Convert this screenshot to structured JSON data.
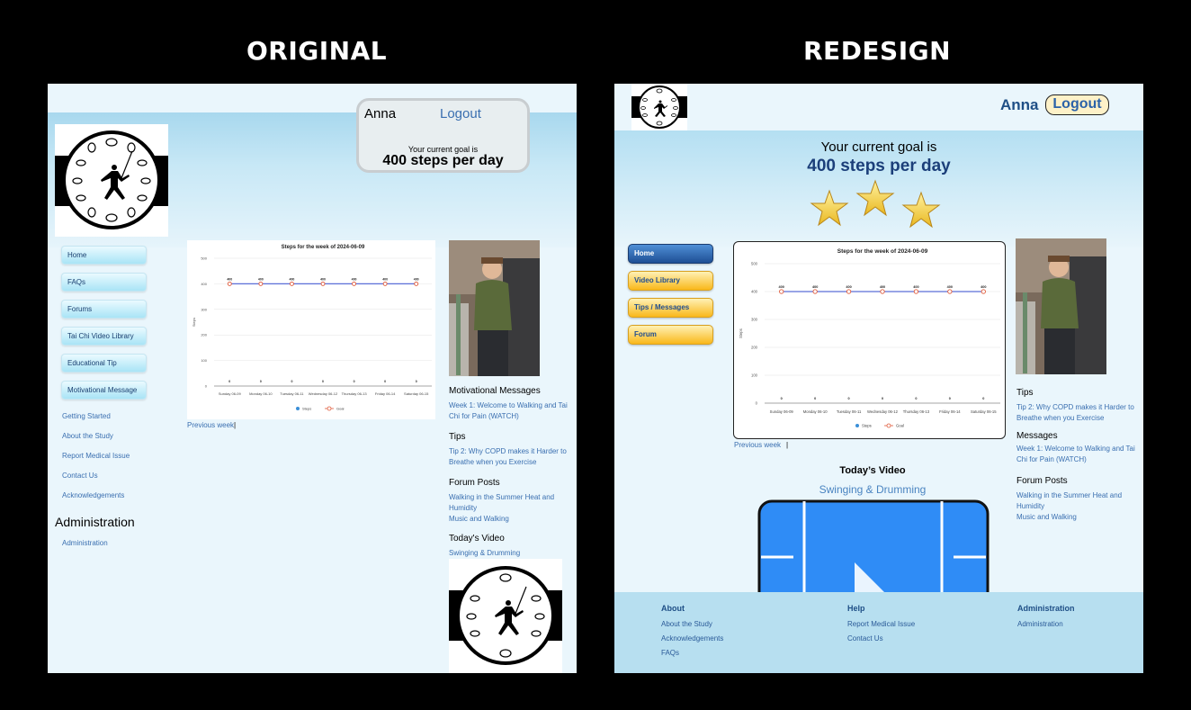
{
  "labels": {
    "original": "ORIGINAL",
    "redesign": "REDESIGN"
  },
  "original": {
    "user": {
      "name": "Anna",
      "logout": "Logout"
    },
    "goal": {
      "intro": "Your current goal is",
      "value": "400 steps per day"
    },
    "nav_buttons": [
      "Home",
      "FAQs",
      "Forums",
      "Tai Chi Video Library",
      "Educational Tip",
      "Motivational Message"
    ],
    "nav_links": [
      "Getting Started",
      "About the Study",
      "Report Medical Issue",
      "Contact Us",
      "Acknowledgements"
    ],
    "admin": {
      "heading": "Administration",
      "link": "Administration"
    },
    "previous_week": "Previous week",
    "separator": "|",
    "side": {
      "motivational_heading": "Motivational Messages",
      "motivational_link": "Week 1: Welcome to Walking and Tai Chi for Pain (WATCH)",
      "tips_heading": "Tips",
      "tips_link": "Tip 2: Why COPD makes it Harder to Breathe when you Exercise",
      "forum_heading": "Forum Posts",
      "forum_links": [
        "Walking in the Summer Heat and Humidity",
        "Music and Walking"
      ],
      "video_heading": "Today's Video",
      "video_link": "Swinging & Drumming"
    }
  },
  "redesign": {
    "user": {
      "name": "Anna",
      "logout": "Logout"
    },
    "goal": {
      "intro": "Your current goal is",
      "value": "400 steps per day"
    },
    "nav_buttons": [
      {
        "label": "Home",
        "style": "blue"
      },
      {
        "label": "Video Library",
        "style": "gold"
      },
      {
        "label": "Tips / Messages",
        "style": "gold"
      },
      {
        "label": "Forum",
        "style": "gold"
      }
    ],
    "previous_week": "Previous week",
    "separator": "|",
    "video": {
      "heading": "Today’s Video",
      "title": "Swinging & Drumming"
    },
    "side": {
      "tips_heading": "Tips",
      "tips_link": "Tip 2: Why COPD makes it Harder to Breathe when you Exercise",
      "messages_heading": "Messages",
      "messages_link": "Week 1: Welcome to Walking and Tai Chi for Pain (WATCH)",
      "forum_heading": "Forum Posts",
      "forum_links": [
        "Walking in the Summer Heat and Humidity",
        "Music and Walking"
      ]
    },
    "footer": {
      "about": {
        "heading": "About",
        "links": [
          "About the Study",
          "Acknowledgements",
          "FAQs"
        ]
      },
      "help": {
        "heading": "Help",
        "links": [
          "Report Medical Issue",
          "Contact Us"
        ]
      },
      "admin": {
        "heading": "Administration",
        "links": [
          "Administration"
        ]
      }
    }
  },
  "colors": {
    "steps": "#3a8fd8",
    "goal_line": "#5a6fd8",
    "goal_marker": "#e05a3a",
    "star": "#f7d23e"
  },
  "chart_data": [
    {
      "type": "line",
      "title": "Steps for the week of 2024-06-09",
      "categories": [
        "Sunday 06-09",
        "Monday 06-10",
        "Tuesday 06-11",
        "Wednesday 06-12",
        "Thursday 06-13",
        "Friday 06-14",
        "Saturday 06-15"
      ],
      "series": [
        {
          "name": "Steps",
          "values": [
            0,
            0,
            0,
            0,
            0,
            0,
            0
          ]
        },
        {
          "name": "Goal",
          "values": [
            400,
            400,
            400,
            400,
            400,
            400,
            400
          ]
        }
      ],
      "ylabel": "Steps",
      "yticks": [
        0,
        100,
        200,
        300,
        400,
        500
      ],
      "ylim": [
        0,
        500
      ],
      "legend": "bottom"
    },
    {
      "type": "line",
      "title": "Steps for the week of 2024-06-09",
      "categories": [
        "Sunday 06-09",
        "Monday 06-10",
        "Tuesday 06-11",
        "Wednesday 06-12",
        "Thursday 06-13",
        "Friday 06-14",
        "Saturday 06-15"
      ],
      "series": [
        {
          "name": "Steps",
          "values": [
            0,
            0,
            0,
            0,
            0,
            0,
            0
          ]
        },
        {
          "name": "Goal",
          "values": [
            400,
            400,
            400,
            400,
            400,
            400,
            400
          ]
        }
      ],
      "ylabel": "Steps",
      "yticks": [
        0,
        100,
        200,
        300,
        400,
        500
      ],
      "ylim": [
        0,
        500
      ],
      "legend": "bottom"
    }
  ]
}
